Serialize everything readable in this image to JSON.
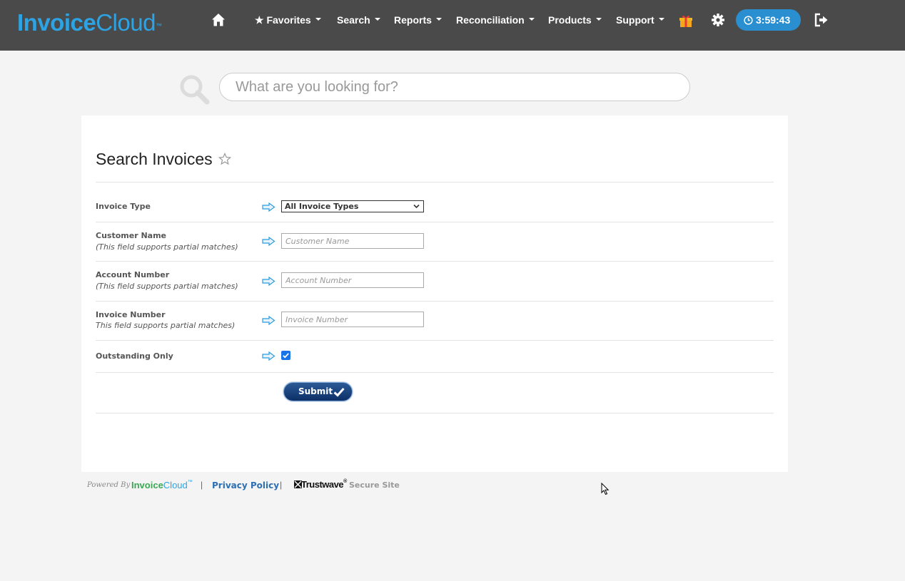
{
  "brand": {
    "logo_bold": "Invoice",
    "logo_light": "Cloud",
    "logo_tm": "™",
    "accent": "#2ea3e3"
  },
  "nav": {
    "items": [
      {
        "label": "★ Favorites"
      },
      {
        "label": "Search"
      },
      {
        "label": "Reports"
      },
      {
        "label": "Reconciliation"
      },
      {
        "label": "Products"
      },
      {
        "label": "Support"
      }
    ],
    "timer": "3:59:43",
    "icons": [
      "home-icon",
      "gift-icon",
      "gear-icon",
      "clock-icon",
      "logout-icon"
    ]
  },
  "search": {
    "placeholder": "What are you looking for?"
  },
  "page": {
    "title": "Search Invoices",
    "fields": {
      "invoice_type": {
        "label": "Invoice Type",
        "value": "All Invoice Types"
      },
      "customer_name": {
        "label": "Customer Name",
        "sublabel": "(This field supports partial matches)",
        "placeholder": "Customer Name",
        "value": ""
      },
      "account_number": {
        "label": "Account Number",
        "sublabel": "(This field supports partial matches)",
        "placeholder": "Account Number",
        "value": ""
      },
      "invoice_number": {
        "label": "Invoice Number",
        "sublabel": "This field supports partial matches)",
        "placeholder": "Invoice Number",
        "value": ""
      },
      "outstanding_only": {
        "label": "Outstanding Only",
        "checked": true
      }
    },
    "submit_label": "Submit"
  },
  "footer": {
    "powered_by": "Powered By",
    "brand_green": "Invoice",
    "brand_blue": "Cloud",
    "brand_tm": "™",
    "sep": "|",
    "privacy": "Privacy Policy",
    "trustwave": "Trustwave",
    "trustwave_tm": "®",
    "secure": "Secure Site"
  }
}
